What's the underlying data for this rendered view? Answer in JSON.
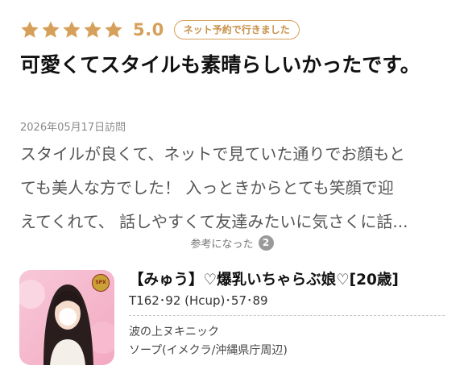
{
  "review": {
    "stars": 5,
    "score": "5.0",
    "badge": "ネット予約で行きました",
    "title": "可愛くてスタイルも素晴らしいかったです。",
    "visit_date": "2026年05月17日訪問",
    "body_lines": [
      "スタイルが良くて、ネットで見ていた通りでお顔もと",
      "ても美人な方でした！ 入っときからとても笑顔で迎",
      "えてくれて、 話しやすくて友達みたいに気さくに話..."
    ],
    "helpful_label": "参考になった",
    "helpful_count": "2",
    "star_color": "#d6a05a"
  },
  "girl_card": {
    "name": "【みゅう】♡爆乳いちゃらぶ娘♡[20歳]",
    "stats": "T162･92 (Hcup)･57･89",
    "shop_name": "波の上ヌキニック",
    "shop_info": "ソープ(イメクラ/沖縄県庁周辺)",
    "photo_badge": "SPX"
  }
}
